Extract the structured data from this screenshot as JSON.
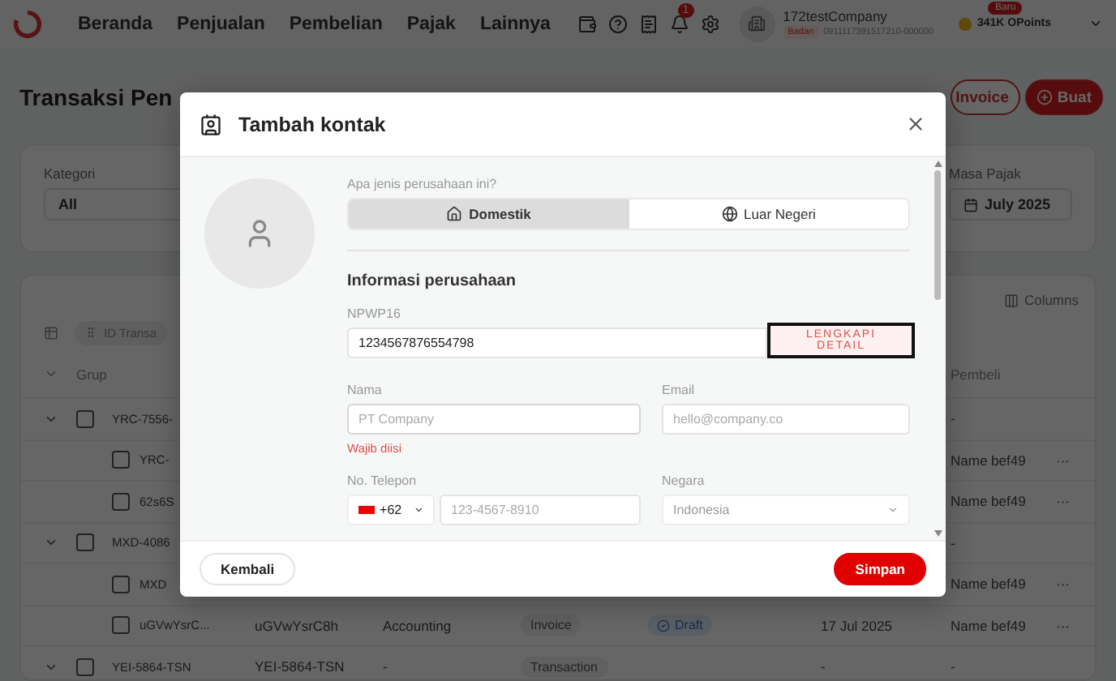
{
  "nav": {
    "items": [
      "Beranda",
      "Penjualan",
      "Pembelian",
      "Pajak",
      "Lainnya"
    ],
    "notification_count": "1"
  },
  "company": {
    "name": "172testCompany",
    "badge": "Badan",
    "id": "0911117391517210-000000"
  },
  "points": {
    "badge": "Baru",
    "label": "341K OPoints"
  },
  "page": {
    "title": "Transaksi Pen",
    "buttons": [
      {
        "label": "Invoice",
        "kind": "outline"
      },
      {
        "label": "Buat",
        "kind": "primary"
      }
    ]
  },
  "filters": [
    {
      "label": "Kategori",
      "value": "All",
      "kind": "select"
    },
    {
      "label": "Masa Pajak",
      "value": "July 2025",
      "kind": "date"
    }
  ],
  "table": {
    "chip": "ID Transa",
    "columns_button": "Columns",
    "header_group": "Grup",
    "header_buyer": "Pembeli",
    "rows": [
      {
        "kind": "group",
        "checked": false,
        "id": "YRC-7556-",
        "buyer": "-"
      },
      {
        "kind": "child",
        "checked": false,
        "id": "YRC-",
        "buyer": "Name bef49",
        "menu": "···"
      },
      {
        "kind": "child",
        "checked": false,
        "id": "62s6S",
        "buyer": "Name bef49",
        "menu": "···"
      },
      {
        "kind": "group",
        "checked": false,
        "id": "MXD-4086",
        "buyer": "-"
      },
      {
        "kind": "child",
        "checked": false,
        "id": "MXD",
        "buyer": "Name bef49",
        "menu": "···"
      },
      {
        "kind": "child",
        "checked": false,
        "id": "uGVwYsrC...",
        "code": "uGVwYsrC8h",
        "category": "Accounting",
        "type": "Invoice",
        "status": "Draft",
        "date": "17 Jul 2025",
        "buyer": "Name bef49",
        "menu": "···"
      },
      {
        "kind": "group",
        "checked": false,
        "id": "YEI-5864-TSN",
        "code": "YEI-5864-TSN",
        "category": "-",
        "type": "Transaction",
        "date": "-",
        "buyer": "-"
      }
    ]
  },
  "dialog": {
    "title": "Tambah kontak",
    "company_type": {
      "question": "Apa jenis perusahaan ini?",
      "options": [
        {
          "label": "Domestik",
          "kind": "home",
          "selected": true
        },
        {
          "label": "Luar Negeri",
          "kind": "globe",
          "selected": false
        }
      ]
    },
    "section_title": "Informasi perusahaan",
    "npwp": {
      "label": "NPWP16",
      "value": "1234567876554798",
      "button": "LENGKAPI DETAIL"
    },
    "name": {
      "label": "Nama",
      "placeholder": "PT Company",
      "error": "Wajib diisi"
    },
    "email": {
      "label": "Email",
      "placeholder": "hello@company.co"
    },
    "phone": {
      "label": "No. Telepon",
      "code": "+62",
      "placeholder": "123-4567-8910"
    },
    "country": {
      "label": "Negara",
      "placeholder": "Indonesia"
    },
    "back_button": "Kembali",
    "save_button": "Simpan"
  }
}
